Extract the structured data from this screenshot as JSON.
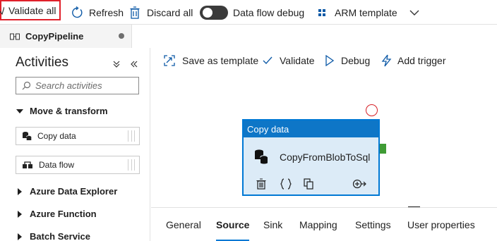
{
  "toolbar": {
    "validate_all": "Validate all",
    "refresh": "Refresh",
    "discard_all": "Discard all",
    "data_flow_debug": "Data flow debug",
    "data_flow_debug_on": false,
    "arm_template": "ARM template"
  },
  "tabs": {
    "pipeline_tab": "CopyPipeline",
    "unsaved": true
  },
  "activities": {
    "title": "Activities",
    "search_placeholder": "Search activities",
    "move_transform": "Move & transform",
    "copy_data": "Copy data",
    "data_flow": "Data flow",
    "categories": [
      "Azure Data Explorer",
      "Azure Function",
      "Batch Service"
    ]
  },
  "canvas_toolbar": {
    "save_as_template": "Save as template",
    "validate": "Validate",
    "debug": "Debug",
    "add_trigger": "Add trigger"
  },
  "activity_node": {
    "type": "Copy data",
    "name": "CopyFromBlobToSql",
    "has_error": true
  },
  "properties_tabs": [
    "General",
    "Source",
    "Sink",
    "Mapping",
    "Settings",
    "User properties"
  ],
  "active_properties_tab": "Source",
  "colors": {
    "accent": "#0078d4",
    "node_header": "#0e76c7",
    "node_body": "#dcebf7",
    "error": "#d61f26",
    "success_port": "#3f9c35",
    "annotation": "#e0202a"
  },
  "icons": {
    "refresh": "refresh-icon",
    "discard": "trash-icon",
    "arm": "arm-template-icon",
    "pipeline": "pipeline-icon",
    "search": "search-icon",
    "database": "database-icon",
    "dataflow": "data-flow-icon",
    "save_template": "save-template-icon",
    "validate": "checkmark-icon",
    "debug": "play-icon",
    "trigger": "lightning-icon"
  }
}
